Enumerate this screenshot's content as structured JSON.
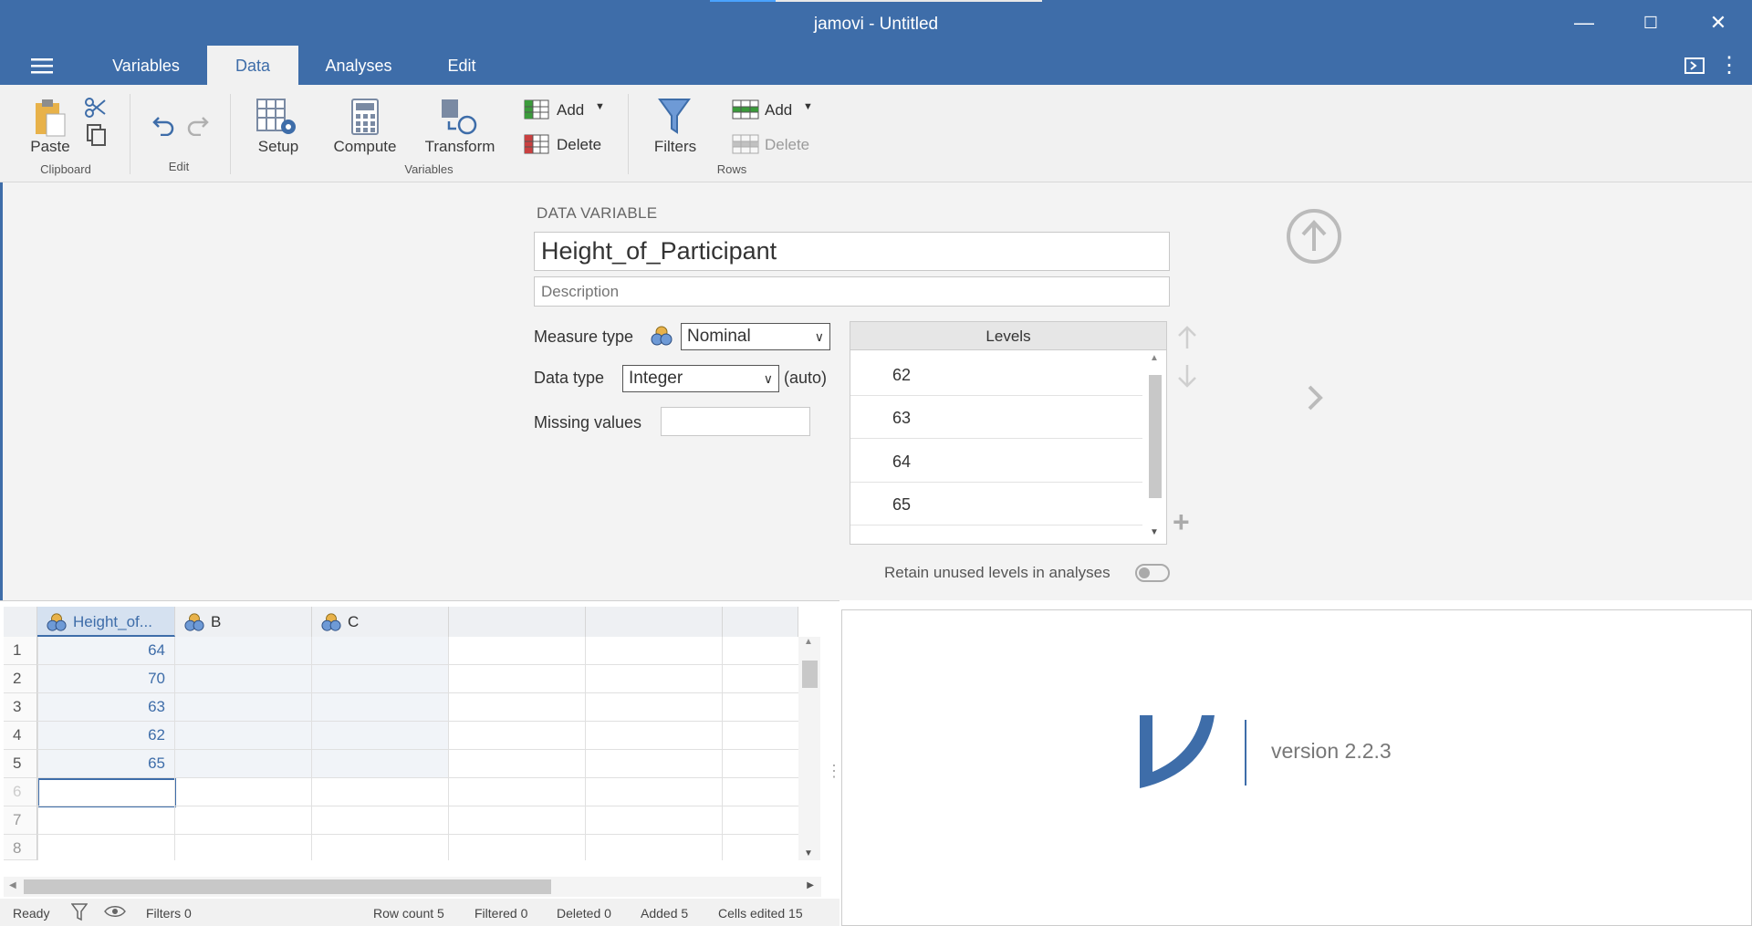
{
  "window": {
    "title": "jamovi - Untitled"
  },
  "tabs": [
    "Variables",
    "Data",
    "Analyses",
    "Edit"
  ],
  "ribbon": {
    "paste": "Paste",
    "clipboard_group": "Clipboard",
    "edit_group": "Edit",
    "setup": "Setup",
    "compute": "Compute",
    "transform": "Transform",
    "var_add": "Add",
    "var_delete": "Delete",
    "variables_group": "Variables",
    "filters": "Filters",
    "row_add": "Add",
    "row_delete": "Delete",
    "rows_group": "Rows"
  },
  "editor": {
    "heading": "DATA VARIABLE",
    "name": "Height_of_Participant",
    "description_placeholder": "Description",
    "measure_label": "Measure type",
    "measure_value": "Nominal",
    "datatype_label": "Data type",
    "datatype_value": "Integer",
    "datatype_auto": "(auto)",
    "missing_label": "Missing values",
    "levels_header": "Levels",
    "levels": [
      "62",
      "63",
      "64",
      "65"
    ],
    "retain_label": "Retain unused levels in analyses"
  },
  "grid": {
    "columns": [
      "Height_of...",
      "B",
      "C"
    ],
    "rows": [
      "1",
      "2",
      "3",
      "4",
      "5",
      "6",
      "7",
      "8"
    ],
    "values": [
      "64",
      "70",
      "63",
      "62",
      "65"
    ]
  },
  "results": {
    "version": "version 2.2.3"
  },
  "status": {
    "ready": "Ready",
    "filters": "Filters 0",
    "row_count": "Row count 5",
    "filtered": "Filtered 0",
    "deleted": "Deleted 0",
    "added": "Added 5",
    "cells_edited": "Cells edited 15"
  },
  "colors": {
    "accent": "#3e6da9",
    "ribbon": "#f1f1f1"
  }
}
